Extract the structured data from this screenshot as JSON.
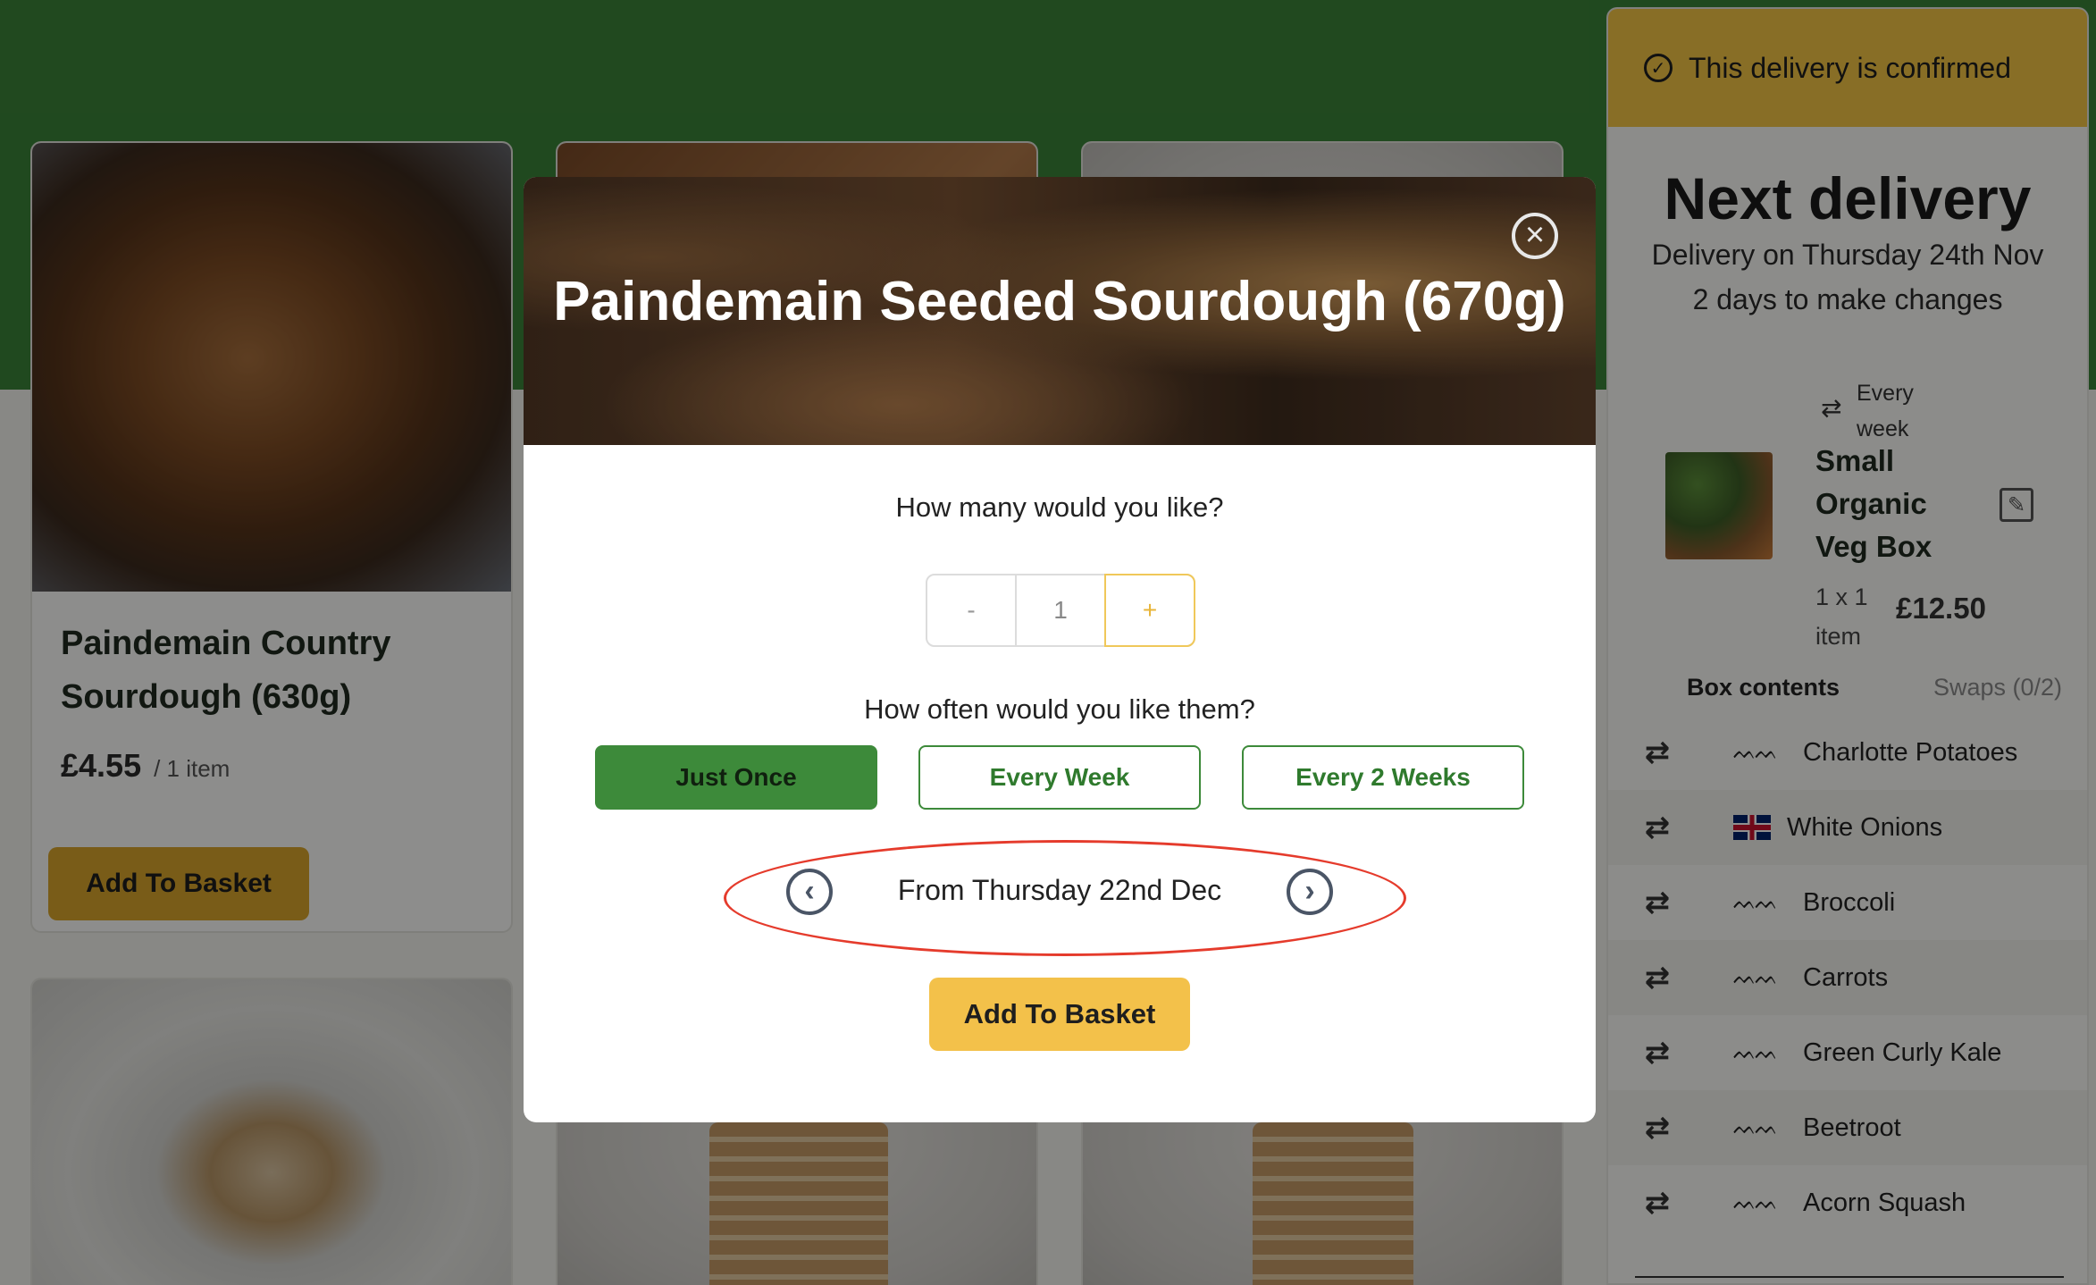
{
  "products": [
    {
      "title": "Paindemain Country Sourdough (630g)",
      "price": "£4.55",
      "per": "/  1 item",
      "button": "Add To Basket"
    }
  ],
  "sidebar": {
    "confirmed_text": "This delivery is confirmed",
    "heading": "Next delivery",
    "delivery_date": "Delivery on Thursday 24th Nov",
    "days_left": "2 days to make changes",
    "box": {
      "frequency_line1": "Every",
      "frequency_line2": "week",
      "name_line1": "Small",
      "name_line2": "Organic",
      "name_line3": "Veg Box",
      "qty_line1": "1 x 1",
      "qty_line2": "item",
      "price": "£12.50"
    },
    "contents_label": "Box contents",
    "swaps_label": "Swaps (0/2)",
    "items": [
      {
        "name": "Charlotte Potatoes",
        "origin": "farm"
      },
      {
        "name": "White Onions",
        "origin": "uk"
      },
      {
        "name": "Broccoli",
        "origin": "farm"
      },
      {
        "name": "Carrots",
        "origin": "farm"
      },
      {
        "name": "Green Curly Kale",
        "origin": "farm"
      },
      {
        "name": "Beetroot",
        "origin": "farm"
      },
      {
        "name": "Acorn Squash",
        "origin": "farm"
      }
    ]
  },
  "modal": {
    "title": "Paindemain Seeded Sourdough (670g)",
    "quantity_question": "How many would you like?",
    "quantity": {
      "minus": "-",
      "value": "1",
      "plus": "+"
    },
    "frequency_question": "How often would you like them?",
    "frequency_options": [
      "Just Once",
      "Every Week",
      "Every 2 Weeks"
    ],
    "selected_frequency": "Just Once",
    "date_text": "From Thursday 22nd Dec",
    "add_button": "Add To Basket"
  },
  "colors": {
    "brand_green": "#3a8238",
    "confirm_yellow": "#f2c544",
    "cta_gold": "#f3c14a",
    "annotation_red": "#e53b2c"
  }
}
